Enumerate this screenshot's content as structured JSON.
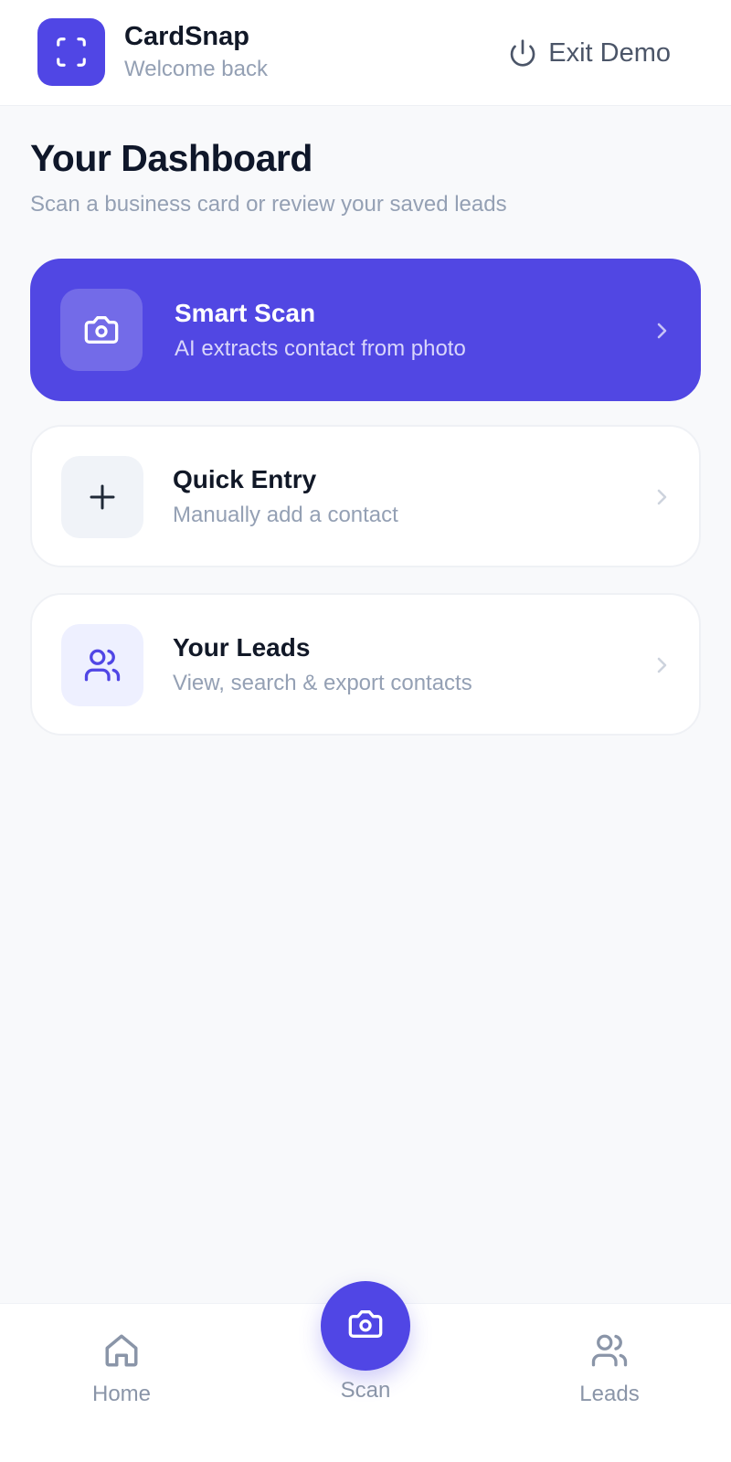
{
  "app": {
    "name": "CardSnap",
    "subtitle": "Welcome back",
    "exit_label": "Exit Demo"
  },
  "dashboard": {
    "title": "Your Dashboard",
    "subtitle": "Scan a business card or review your saved leads"
  },
  "actions": [
    {
      "title": "Smart Scan",
      "description": "AI extracts contact from photo",
      "icon": "camera-icon"
    },
    {
      "title": "Quick Entry",
      "description": "Manually add a contact",
      "icon": "plus-icon"
    },
    {
      "title": "Your Leads",
      "description": "View, search & export contacts",
      "icon": "users-icon"
    }
  ],
  "nav": {
    "home": "Home",
    "scan": "Scan",
    "leads": "Leads"
  },
  "colors": {
    "accent": "#5046e5",
    "background": "#f8f9fb",
    "muted_text": "#94a0b4"
  }
}
